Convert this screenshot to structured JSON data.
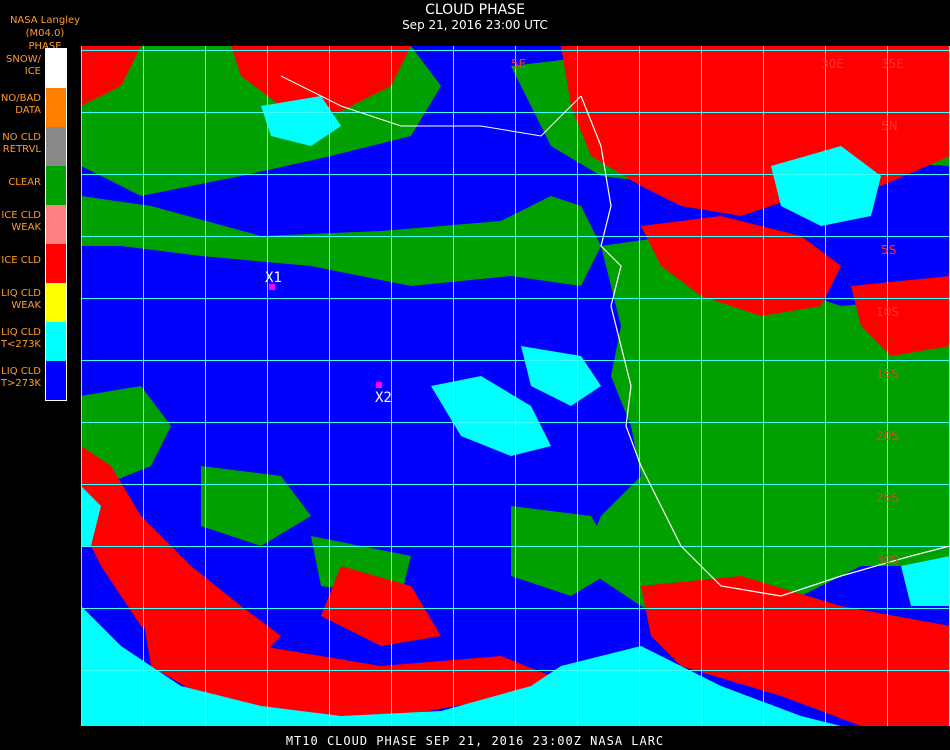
{
  "header": {
    "source_line": "NASA Langley (M04.0)",
    "legend_title": "PHASE",
    "title": "CLOUD PHASE",
    "subtitle": "Sep 21, 2016 23:00 UTC"
  },
  "legend": {
    "items": [
      {
        "label_line1": "SNOW/",
        "label_line2": "ICE",
        "color": "#ffffff"
      },
      {
        "label_line1": "NO/BAD",
        "label_line2": "DATA",
        "color": "#ff8000"
      },
      {
        "label_line1": "NO CLD",
        "label_line2": "RETRVL",
        "color": "#888888"
      },
      {
        "label_line1": "CLEAR",
        "label_line2": "",
        "color": "#00a000"
      },
      {
        "label_line1": "ICE CLD",
        "label_line2": "WEAK",
        "color": "#ff8080"
      },
      {
        "label_line1": "ICE CLD",
        "label_line2": "",
        "color": "#ff0000"
      },
      {
        "label_line1": "LIQ CLD",
        "label_line2": "WEAK",
        "color": "#ffff00"
      },
      {
        "label_line1": "LIQ CLD",
        "label_line2": "T<273K",
        "color": "#00ffff"
      },
      {
        "label_line1": "LIQ CLD",
        "label_line2": "T>273K",
        "color": "#0000ff"
      }
    ]
  },
  "map": {
    "grid_color": "#40ffff",
    "lon_labels": [
      "5E",
      "30E",
      "35E"
    ],
    "lat_labels": [
      "5N",
      "5S",
      "10S",
      "15S",
      "20S",
      "25S",
      "30S"
    ],
    "markers": [
      {
        "label": "X1",
        "color": "#ff00ff"
      },
      {
        "label": "X2",
        "color": "#ff00ff"
      }
    ]
  },
  "footer": {
    "text": "MT10  CLOUD PHASE   SEP 21, 2016 23:00Z   NASA LARC"
  }
}
